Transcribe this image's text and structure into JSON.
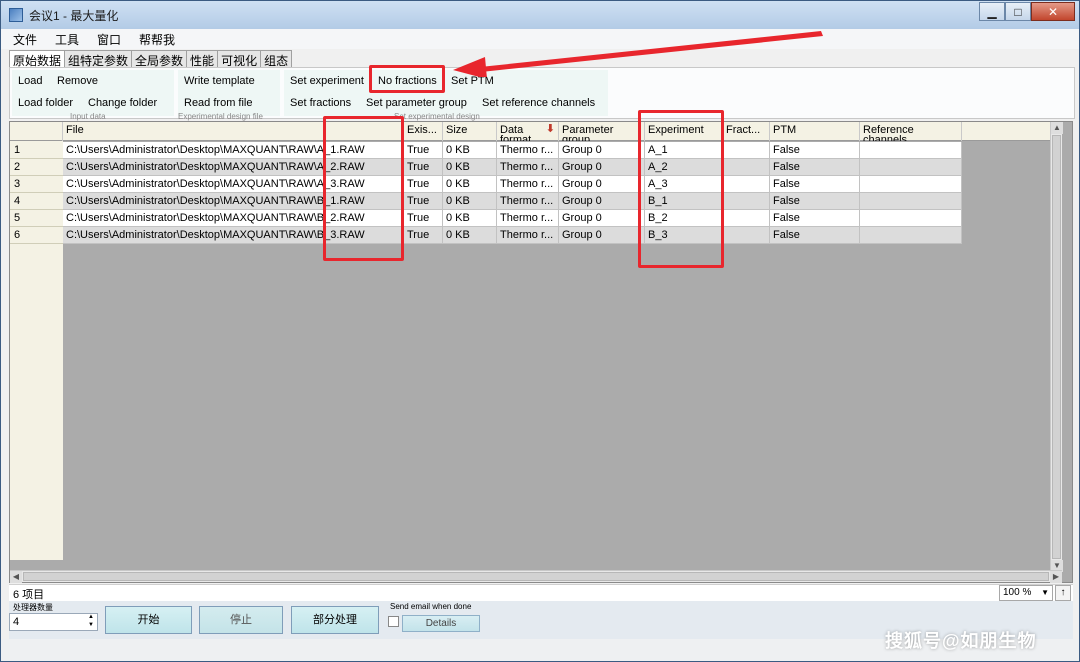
{
  "window": {
    "title": "会议1 - 最大量化",
    "minimize": "▁",
    "maximize": "□",
    "close": "✕"
  },
  "menu": [
    "文件",
    "工具",
    "窗口",
    "帮帮我"
  ],
  "tabs": [
    "原始数据",
    "组特定参数",
    "全局参数",
    "性能",
    "可视化",
    "组态"
  ],
  "ribbon": {
    "input_data": {
      "load": "Load",
      "remove": "Remove",
      "load_folder": "Load folder",
      "change_folder": "Change folder",
      "label": "Input data"
    },
    "experimental_design_file": {
      "write_template": "Write template",
      "read_from_file": "Read from file",
      "label": "Experimental design file"
    },
    "set_experimental_design": {
      "set_experiment": "Set experiment",
      "no_fractions": "No fractions",
      "set_ptm": "Set PTM",
      "set_fractions": "Set fractions",
      "set_parameter_group": "Set parameter group",
      "set_reference_channels": "Set reference channels",
      "label": "Set experimental design"
    }
  },
  "table": {
    "columns": [
      "File",
      "Exis...",
      "Size",
      "Data format",
      "Parameter group",
      "Experiment",
      "Fract...",
      "PTM",
      "Reference channels"
    ],
    "rows": [
      {
        "num": "1",
        "file": "C:\\Users\\Administrator\\Desktop\\MAXQUANT\\RAW\\A_1.RAW",
        "exists": "True",
        "size": "0 KB",
        "format": "Thermo r...",
        "group": "Group 0",
        "experiment": "A_1",
        "fraction": "",
        "ptm": "False",
        "ref": ""
      },
      {
        "num": "2",
        "file": "C:\\Users\\Administrator\\Desktop\\MAXQUANT\\RAW\\A_2.RAW",
        "exists": "True",
        "size": "0 KB",
        "format": "Thermo r...",
        "group": "Group 0",
        "experiment": "A_2",
        "fraction": "",
        "ptm": "False",
        "ref": ""
      },
      {
        "num": "3",
        "file": "C:\\Users\\Administrator\\Desktop\\MAXQUANT\\RAW\\A_3.RAW",
        "exists": "True",
        "size": "0 KB",
        "format": "Thermo r...",
        "group": "Group 0",
        "experiment": "A_3",
        "fraction": "",
        "ptm": "False",
        "ref": ""
      },
      {
        "num": "4",
        "file": "C:\\Users\\Administrator\\Desktop\\MAXQUANT\\RAW\\B_1.RAW",
        "exists": "True",
        "size": "0 KB",
        "format": "Thermo r...",
        "group": "Group 0",
        "experiment": "B_1",
        "fraction": "",
        "ptm": "False",
        "ref": ""
      },
      {
        "num": "5",
        "file": "C:\\Users\\Administrator\\Desktop\\MAXQUANT\\RAW\\B_2.RAW",
        "exists": "True",
        "size": "0 KB",
        "format": "Thermo r...",
        "group": "Group 0",
        "experiment": "B_2",
        "fraction": "",
        "ptm": "False",
        "ref": ""
      },
      {
        "num": "6",
        "file": "C:\\Users\\Administrator\\Desktop\\MAXQUANT\\RAW\\B_3.RAW",
        "exists": "True",
        "size": "0 KB",
        "format": "Thermo r...",
        "group": "Group 0",
        "experiment": "B_3",
        "fraction": "",
        "ptm": "False",
        "ref": ""
      }
    ]
  },
  "status": {
    "items_count": "6 项目",
    "zoom": "100 %"
  },
  "bottom": {
    "threads_label": "处理器数量",
    "threads_value": "4",
    "start": "开始",
    "stop": "停止",
    "partial": "部分处理",
    "email_label": "Send email when done",
    "details": "Details"
  },
  "watermark": "搜狐号@如朋生物",
  "colors": {
    "annotation": "#e8262d",
    "ribbon_group": "#eef7f5",
    "row_alt": "#dcdcdc"
  }
}
